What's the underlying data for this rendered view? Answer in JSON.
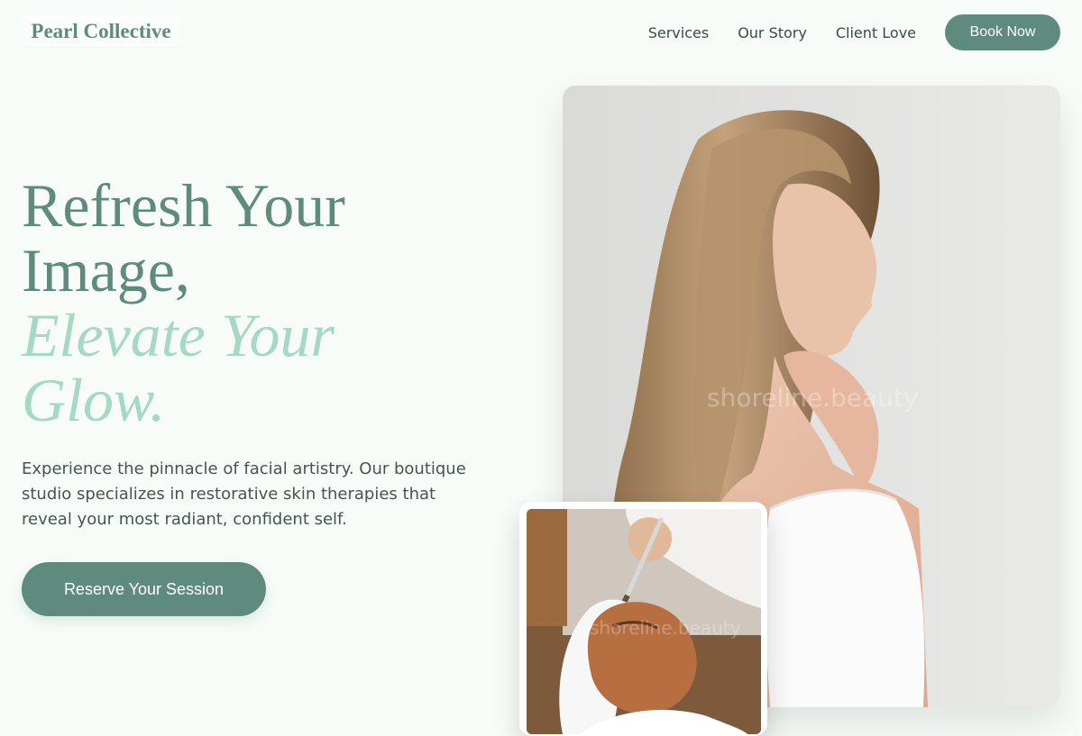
{
  "brand": {
    "name": "Pearl Collective"
  },
  "nav": {
    "links": [
      "Services",
      "Our Story",
      "Client Love"
    ],
    "cta": "Book Now"
  },
  "hero": {
    "headline_line1": "Refresh Your",
    "headline_line2": "Image,",
    "headline_accent1": "Elevate Your",
    "headline_accent2": "Glow.",
    "lead": "Experience the pinnacle of facial artistry. Our boutique studio specializes in restorative skin therapies that reveal your most radiant, confident self.",
    "cta": "Reserve Your Session"
  },
  "images": {
    "main_watermark": "shoreline.beauty",
    "small_watermark": "shoreline.beauty"
  },
  "colors": {
    "accent": "#5e8b7d",
    "accent_light": "#a6d8c7",
    "background": "#f7fcf9",
    "body_text": "#485451"
  }
}
